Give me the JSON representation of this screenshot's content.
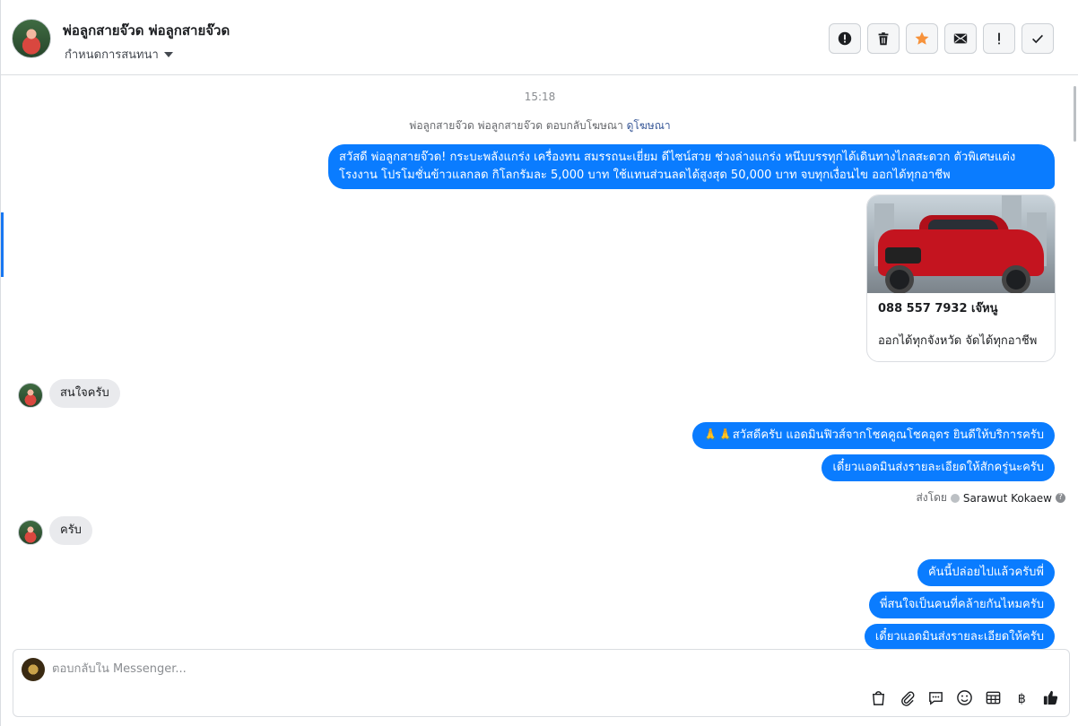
{
  "header": {
    "contact_name": "พ่อลูกสายจ๊วด พ่อลูกสายจ๊วด",
    "assign_label": "กำหนดการสนทนา",
    "actions": [
      {
        "name": "report-icon",
        "glyph": "!"
      },
      {
        "name": "trash-icon"
      },
      {
        "name": "star-icon"
      },
      {
        "name": "mail-icon"
      },
      {
        "name": "exclamation-icon",
        "glyph": "!"
      },
      {
        "name": "check-icon"
      }
    ]
  },
  "conversation": {
    "timestamp": "15:18",
    "reply_note_prefix": "พ่อลูกสายจ๊วด พ่อลูกสายจ๊วด ตอบกลับโฆษณา",
    "reply_note_link": "ดูโฆษณา",
    "messages": {
      "m1": "สวัสดี พ่อลูกสายจ๊วด! กระบะพลังแกร่ง เครื่องทน สมรรถนะเยี่ยม ดีไซน์สวย ช่วงล่างแกร่ง หนึบบรรทุกได้เดินทางไกลสะดวก ตัวพิเศษแต่งโรงงาน โปรโมชั่นข้าวแลกลด กิโลกรัมละ 5,000 บาท ใช้แทนส่วนลดได้สูงสุด 50,000 บาท จบทุกเงื่อนไข ออกได้ทุกอาชีพ",
      "card_line1": "088 557 7932 เจ๊หนู",
      "card_line2": "ออกได้ทุกจังหวัด จัดได้ทุกอาชีพ",
      "m2": "สนใจครับ",
      "m3": "🙏🙏สวัสดีครับ แอดมินฟิวส์จากโชคคูณโชคอุดร ยินดีให้บริการครับ",
      "m4": "เดี๋ยวแอดมินส่งรายละเอียดให้สักครู่นะครับ",
      "m5": "ครับ",
      "m6": "คันนี้ปล่อยไปแล้วครับพี่",
      "m7": "พี่สนใจเป็นคนที่คล้ายกันไหมครับ",
      "m8": "เดี๋ยวแอดมินส่งรายละเอียดให้ครับ"
    },
    "sent_by_prefix": "ส่งโดย",
    "sent_by_name": "Sarawut Kokaew",
    "sent_by_help": "?"
  },
  "composer": {
    "placeholder": "ตอบกลับใน Messenger..."
  },
  "colors": {
    "accent": "#1877f2",
    "outgoing_bubble": "#0a7cff",
    "incoming_bubble": "#e9eaed",
    "star": "#f7923b"
  }
}
